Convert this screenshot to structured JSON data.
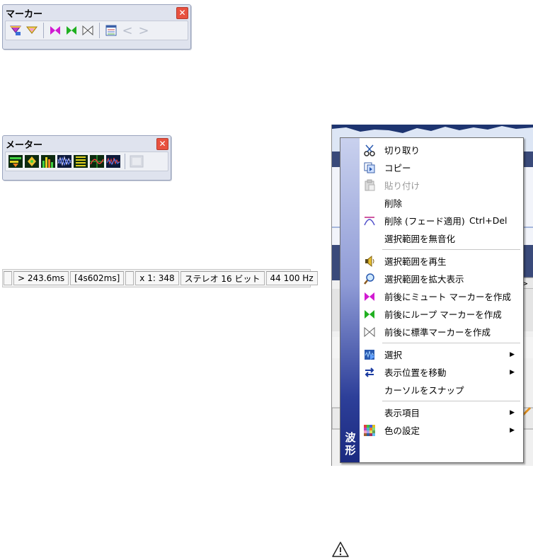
{
  "marker_toolbar": {
    "title": "マーカー",
    "buttons": [
      "filter-marker-icon",
      "drop-marker-icon",
      "mute-marker-icon",
      "loop-marker-icon",
      "standard-marker-icon",
      "marker-list-icon",
      "prev-marker-icon",
      "next-marker-icon"
    ]
  },
  "meter_toolbar": {
    "title": "メーター",
    "buttons": [
      "level-meter-icon",
      "pan-meter-icon",
      "spectrum-meter-icon",
      "bit-meter-icon",
      "phase-meter-icon",
      "oscilloscope-icon",
      "waveform-meter-icon",
      "disabled-meter-icon"
    ]
  },
  "status_bar": {
    "cells": [
      "",
      "> 243.6ms",
      "[4s602ms]",
      "",
      "x 1: 348",
      "ステレオ 16 ビット",
      "44 100 Hz"
    ]
  },
  "context_menu": {
    "side_label": [
      "波",
      "形"
    ],
    "groups": [
      [
        {
          "icon": "scissors-icon",
          "label": "切り取り"
        },
        {
          "icon": "copy-icon",
          "label": "コピー"
        },
        {
          "icon": "paste-icon",
          "label": "貼り付け",
          "disabled": true
        },
        {
          "icon": "",
          "label": "削除"
        },
        {
          "icon": "crossfade-delete-icon",
          "label": "削除 (フェード適用)",
          "shortcut": "Ctrl+Del"
        },
        {
          "icon": "",
          "label": "選択範囲を無音化"
        }
      ],
      [
        {
          "icon": "speaker-icon",
          "label": "選択範囲を再生"
        },
        {
          "icon": "magnifier-icon",
          "label": "選択範囲を拡大表示"
        },
        {
          "icon": "mute-marker-icon",
          "label": "前後にミュート マーカーを作成"
        },
        {
          "icon": "loop-marker-icon",
          "label": "前後にループ マーカーを作成"
        },
        {
          "icon": "standard-marker-icon",
          "label": "前後に標準マーカーを作成"
        }
      ],
      [
        {
          "icon": "select-icon",
          "label": "選択",
          "submenu": true
        },
        {
          "icon": "swap-arrows-icon",
          "label": "表示位置を移動",
          "submenu": true
        },
        {
          "icon": "",
          "label": "カーソルをスナップ"
        }
      ],
      [
        {
          "icon": "",
          "label": "表示項目",
          "submenu": true
        },
        {
          "icon": "color-grid-icon",
          "label": "色の設定",
          "submenu": true
        }
      ]
    ]
  },
  "colors": {
    "mute_marker": "#d11ad1",
    "loop_marker": "#20b020",
    "menu_sidebar_dark": "#1b2a80",
    "close_button": "#e8513f"
  }
}
